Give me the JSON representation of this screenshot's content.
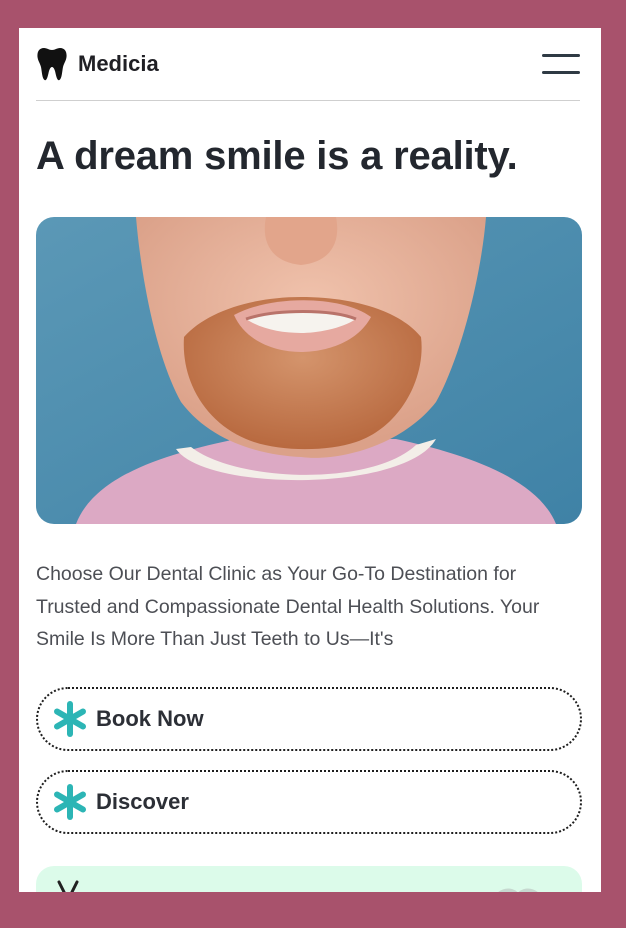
{
  "header": {
    "brand_name": "Medicia",
    "logo_icon": "tooth-icon",
    "menu_icon": "hamburger-menu-icon"
  },
  "hero": {
    "title": "A dream smile is a reality.",
    "image_subject": "smiling-man-photo",
    "description": "Choose Our Dental Clinic as Your Go-To Destination for Trusted and Compassionate Dental Health Solutions. Your Smile Is More Than Just Teeth to Us—It's"
  },
  "actions": {
    "book_label": "Book Now",
    "discover_label": "Discover",
    "button_icon": "asterisk-icon"
  },
  "colors": {
    "page_background": "#a8526c",
    "accent_teal": "#2cb5b5",
    "card_mint": "#dcfbea",
    "text_dark": "#23272e"
  }
}
